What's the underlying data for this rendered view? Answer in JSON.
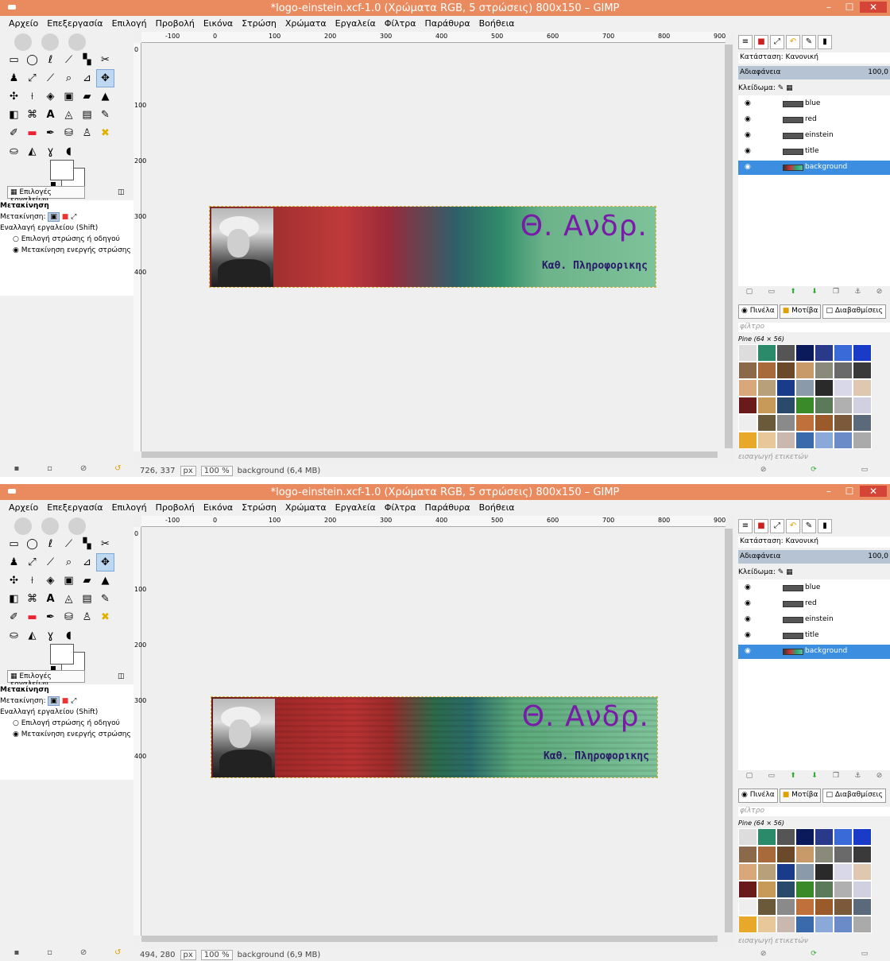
{
  "window_title": "*logo-einstein.xcf-1.0 (Χρώματα RGB, 5 στρώσεις) 800x150 – GIMP",
  "menu": [
    "Αρχείο",
    "Επεξεργασία",
    "Επιλογή",
    "Προβολή",
    "Εικόνα",
    "Στρώση",
    "Χρώματα",
    "Εργαλεία",
    "Φίλτρα",
    "Παράθυρα",
    "Βοήθεια"
  ],
  "window_controls": {
    "minimize": "–",
    "maximize": "☐",
    "close": "✕"
  },
  "ruler_h": [
    "-100",
    "0",
    "100",
    "200",
    "300",
    "400",
    "500",
    "600",
    "700",
    "800",
    "900"
  ],
  "ruler_v": [
    "0",
    "100",
    "200",
    "300",
    "400"
  ],
  "tool_options": {
    "tab_label": "Επιλογές εργαλείων",
    "heading": "Μετακίνηση",
    "move_label": "Μετακίνηση:",
    "toggle_label": "Εναλλαγή εργαλείου  (Shift)",
    "radio_1": "Επιλογή στρώσης ή οδηγού",
    "radio_2": "Μετακίνηση ενεργής στρώσης"
  },
  "banner": {
    "title": "Θ. Ανδρ.",
    "subtitle": "Καθ. Πληροφορικης"
  },
  "status_top": {
    "coords": "726, 337",
    "unit": "px",
    "zoom": "100 %",
    "info": "background (6,4 MB)"
  },
  "status_bottom": {
    "coords": "494, 280",
    "unit": "px",
    "zoom": "100 %",
    "info": "background (6,9 MB)"
  },
  "layers_panel": {
    "mode": "Κατάσταση: Κανονική",
    "opacity_label": "Αδιαφάνεια",
    "opacity_value": "100,0",
    "lock_label": "Κλείδωμα:",
    "layers": [
      "blue",
      "red",
      "einstein",
      "title",
      "background"
    ],
    "active_layer": "background"
  },
  "brush_tabs": [
    "Πινέλα",
    "Μοτίβα",
    "Διαβαθμίσεις"
  ],
  "filter_placeholder": "φίλτρο",
  "pattern_name": "Pine (64 × 56)",
  "tag_placeholder": "εισαγωγή ετικετών",
  "accent": "#3b8ee0",
  "titlebar_color": "#e98a5f"
}
